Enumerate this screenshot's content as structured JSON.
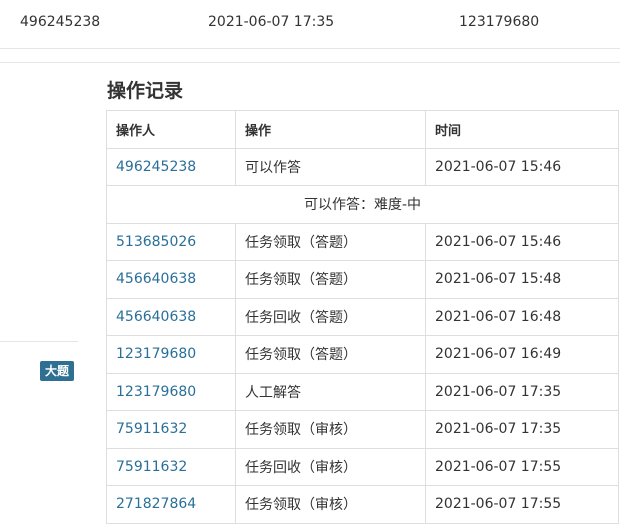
{
  "top_row": {
    "user_id": "496245238",
    "datetime": "2021-06-07 17:35",
    "operator_id": "123179680"
  },
  "sidebar": {
    "tag_label": "大题"
  },
  "operations": {
    "title": "操作记录",
    "headers": {
      "operator": "操作人",
      "action": "操作",
      "time": "时间"
    },
    "first_row": {
      "operator": "496245238",
      "action": "可以作答",
      "time": "2021-06-07 15:46"
    },
    "detail_text": "可以作答：难度-中",
    "rows": [
      {
        "operator": "513685026",
        "action": "任务领取（答题）",
        "time": "2021-06-07 15:46"
      },
      {
        "operator": "456640638",
        "action": "任务领取（答题）",
        "time": "2021-06-07 15:48"
      },
      {
        "operator": "456640638",
        "action": "任务回收（答题）",
        "time": "2021-06-07 16:48"
      },
      {
        "operator": "123179680",
        "action": "任务领取（答题）",
        "time": "2021-06-07 16:49"
      },
      {
        "operator": "123179680",
        "action": "人工解答",
        "time": "2021-06-07 17:35"
      },
      {
        "operator": "75911632",
        "action": "任务领取（审核）",
        "time": "2021-06-07 17:35"
      },
      {
        "operator": "75911632",
        "action": "任务回收（审核）",
        "time": "2021-06-07 17:55"
      },
      {
        "operator": "271827864",
        "action": "任务领取（审核）",
        "time": "2021-06-07 17:55"
      }
    ]
  },
  "colors": {
    "link": "#2a6f99",
    "tag_bg": "#2f6f91",
    "border": "#dedede"
  }
}
